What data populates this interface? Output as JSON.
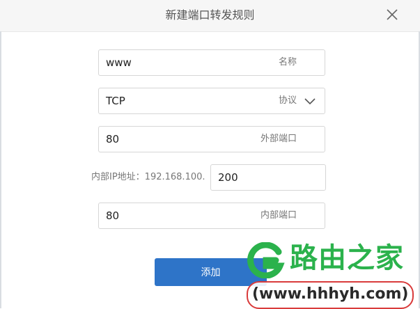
{
  "dialog": {
    "title": "新建端口转发规则",
    "close_icon": "close-icon"
  },
  "form": {
    "name": {
      "value": "www",
      "hint": "名称"
    },
    "protocol": {
      "value": "TCP",
      "hint": "协议",
      "icon": "chevron-down-icon"
    },
    "external_port": {
      "value": "80",
      "hint": "外部端口"
    },
    "internal_ip": {
      "label": "内部IP地址：192.168.100.",
      "value": "200"
    },
    "internal_port": {
      "value": "80",
      "hint": "内部端口"
    },
    "add_label": "添加"
  },
  "watermark": {
    "brand": "路由之家",
    "url": "(www.hhhyh.com)"
  },
  "colors": {
    "primary": "#2e74c8",
    "watermark_green": "#2bb24c",
    "watermark_red": "#d93b3b"
  }
}
